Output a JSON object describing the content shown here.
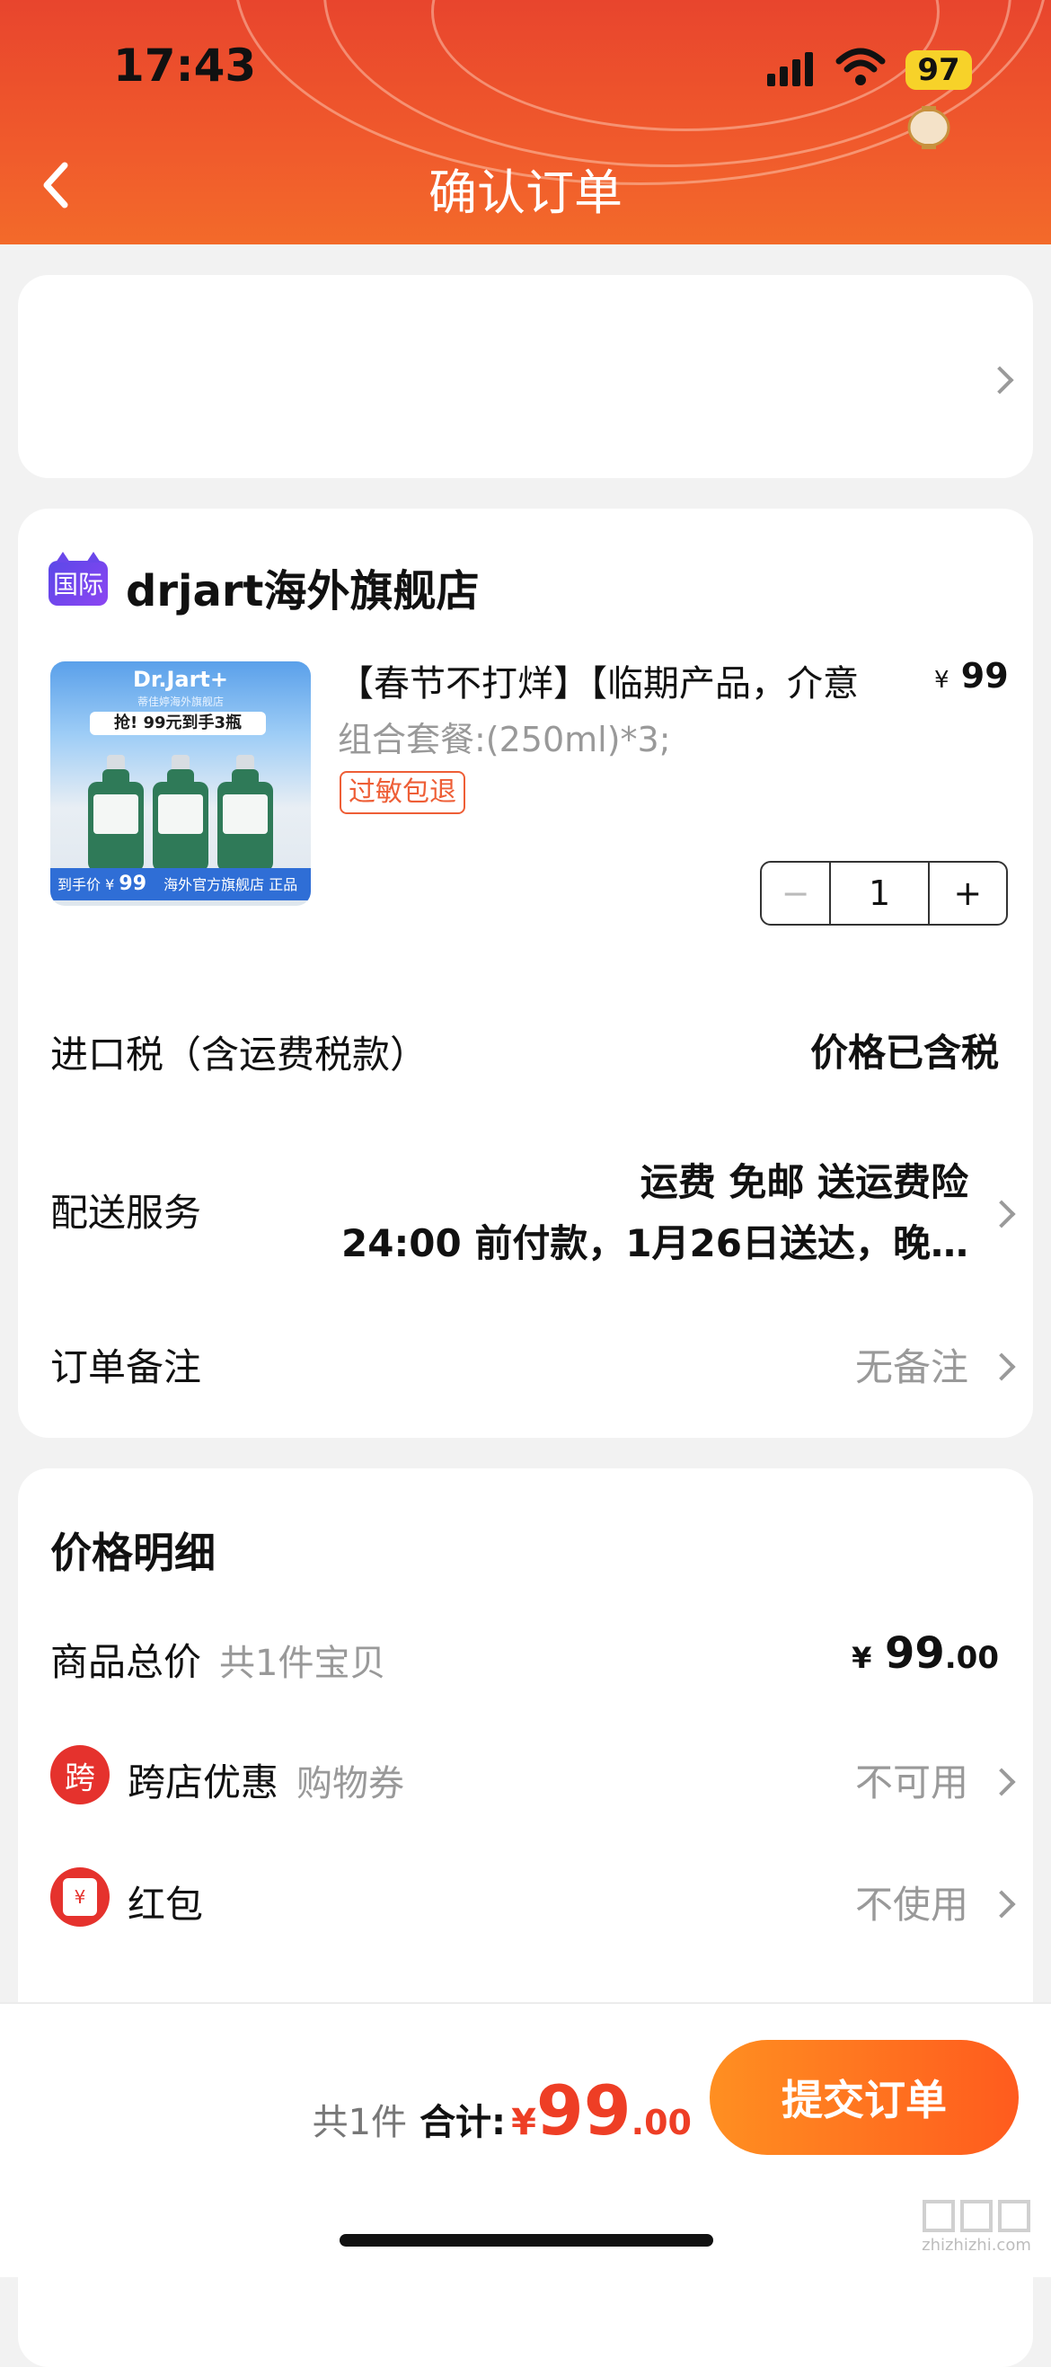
{
  "status_bar": {
    "time": "17:43",
    "battery": "97",
    "icons": [
      "signal-icon",
      "wifi-icon",
      "battery-icon",
      "lantern-icon"
    ]
  },
  "header": {
    "title": "确认订单",
    "back_icon": "chevron-left-icon",
    "bg_color": "#f05a2c"
  },
  "address": {
    "text": ""
  },
  "store": {
    "badge": "国际",
    "name": "drjart海外旗舰店"
  },
  "product": {
    "title": "【春节不打烊】【临期产品，介意",
    "price_symbol": "¥",
    "price": "99",
    "spec": "组合套餐:(250ml)*3;",
    "tag": "过敏包退",
    "quantity": "1",
    "minus": "−",
    "plus": "+",
    "thumb": {
      "brand": "Dr.Jart+",
      "subbrand": "蒂佳婷海外旗舰店",
      "promo": "抢! 99元到手3瓶",
      "price_label": "到手价",
      "price_symbol": "¥",
      "price_value": "99",
      "footer": "海外官方旗舰店 正品保障"
    }
  },
  "rows": {
    "tax": {
      "label": "进口税（含运费税款）",
      "value": "价格已含税"
    },
    "delivery": {
      "label": "配送服务",
      "line1": "运费 免邮 送运费险",
      "line2": "24:00 前付款，1月26日送达，晚…"
    },
    "note": {
      "label": "订单备注",
      "value": "无备注"
    }
  },
  "price_detail": {
    "title": "价格明细",
    "goods_total": {
      "label": "商品总价",
      "sub": "共1件宝贝",
      "symbol": "¥",
      "int": "99",
      "dec": ".00"
    },
    "cross_store": {
      "icon_text": "跨",
      "label": "跨店优惠",
      "sub": "购物券",
      "value": "不可用"
    },
    "red_packet": {
      "icon_text": "¥",
      "label": "红包",
      "value": "不使用"
    }
  },
  "footer": {
    "count": "共1件",
    "total_label": "合计:",
    "symbol": "¥",
    "int": "99",
    "dec": ".00",
    "submit": "提交订单"
  },
  "watermark": {
    "text": "zhizhizhi.com"
  },
  "colors": {
    "accent": "#ee3e25",
    "button_start": "#ff8f21",
    "button_end": "#ff5b1e"
  }
}
